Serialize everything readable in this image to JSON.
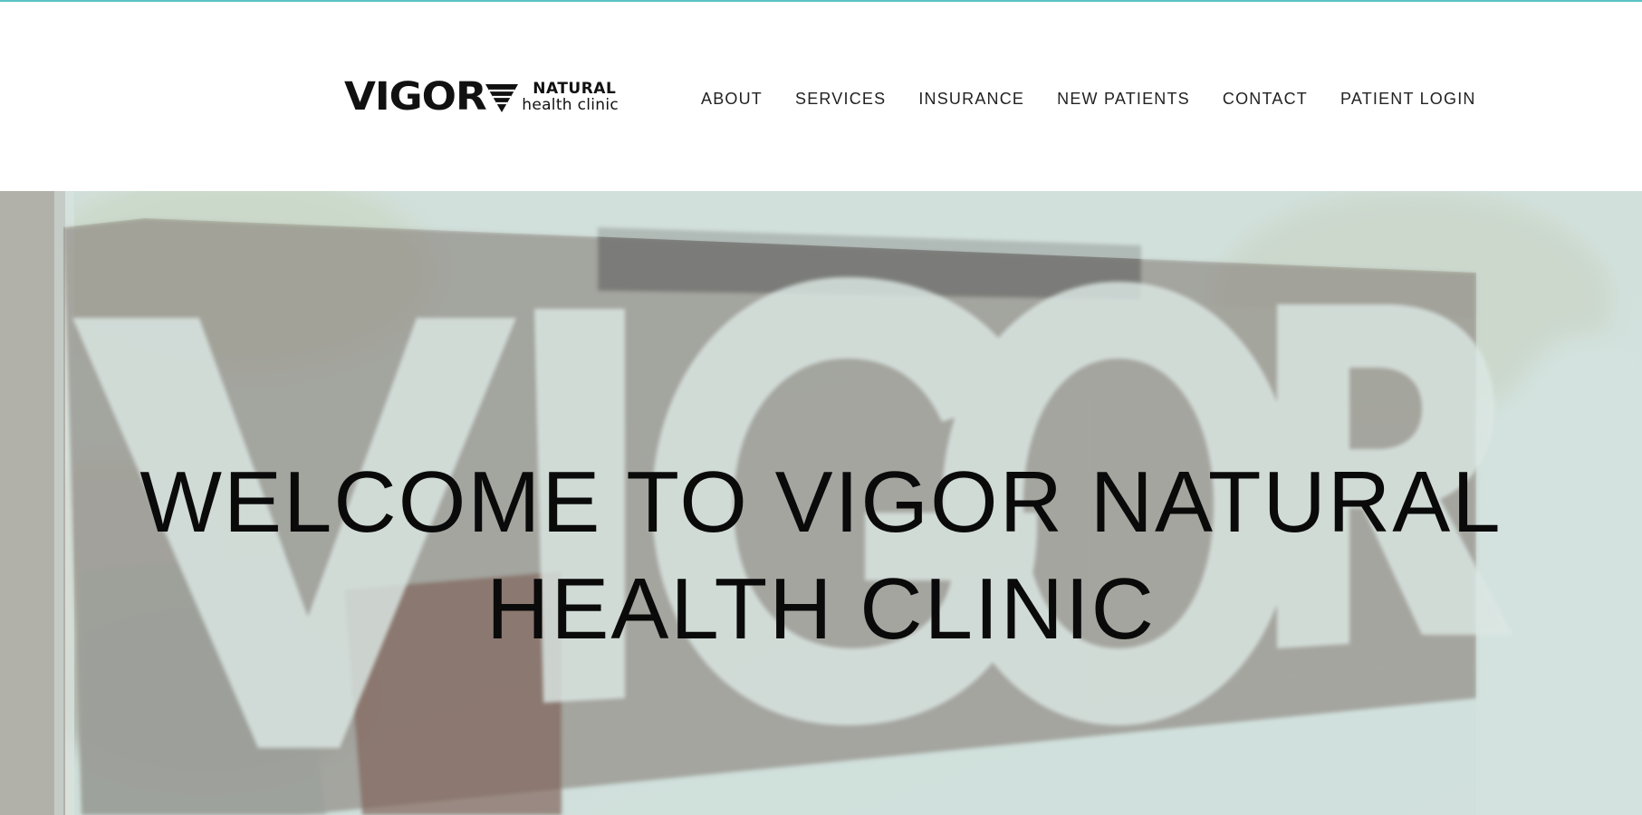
{
  "brand": {
    "name": "VIGOR",
    "tagline_line1": "NATURAL",
    "tagline_line2": "health clinic"
  },
  "nav": {
    "items": [
      {
        "label": "ABOUT"
      },
      {
        "label": "SERVICES"
      },
      {
        "label": "INSURANCE"
      },
      {
        "label": "NEW PATIENTS"
      },
      {
        "label": "CONTACT"
      },
      {
        "label": "PATIENT LOGIN"
      }
    ]
  },
  "hero": {
    "title_line1": "WELCOME TO VIGOR NATURAL",
    "title_line2": "HEALTH CLINIC",
    "background_word": "VIGOR"
  },
  "colors": {
    "accent": "#5bc3c3",
    "text": "#0a0a0a",
    "hero_tint": "#c7d6d3"
  }
}
